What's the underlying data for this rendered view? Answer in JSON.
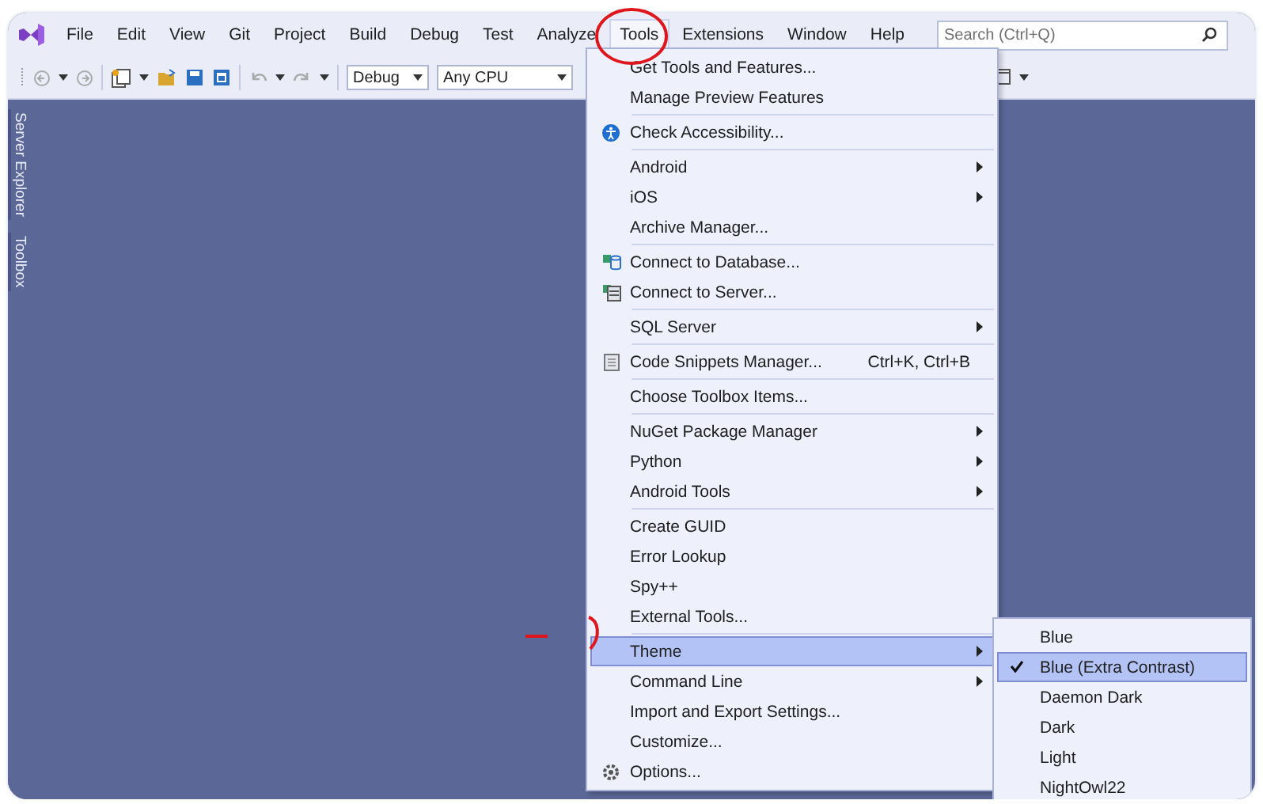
{
  "menu_bar": [
    {
      "label": "File",
      "selected": false
    },
    {
      "label": "Edit",
      "selected": false
    },
    {
      "label": "View",
      "selected": false
    },
    {
      "label": "Git",
      "selected": false
    },
    {
      "label": "Project",
      "selected": false
    },
    {
      "label": "Build",
      "selected": false
    },
    {
      "label": "Debug",
      "selected": false
    },
    {
      "label": "Test",
      "selected": false
    },
    {
      "label": "Analyze",
      "selected": false
    },
    {
      "label": "Tools",
      "selected": true
    },
    {
      "label": "Extensions",
      "selected": false
    },
    {
      "label": "Window",
      "selected": false
    },
    {
      "label": "Help",
      "selected": false
    }
  ],
  "search": {
    "placeholder": "Search (Ctrl+Q)"
  },
  "toolbar": {
    "configuration": "Debug",
    "platform": "Any CPU"
  },
  "side_tabs": [
    "Server Explorer",
    "Toolbox"
  ],
  "tools_menu": [
    [
      {
        "label": "Get Tools and Features...",
        "submenu": false,
        "highlighted": false
      },
      {
        "label": "Manage Preview Features",
        "submenu": false,
        "highlighted": false
      }
    ],
    [
      {
        "label": "Check Accessibility...",
        "kind": "accessibility",
        "submenu": false,
        "highlighted": false
      }
    ],
    [
      {
        "label": "Android",
        "submenu": true,
        "highlighted": false
      },
      {
        "label": "iOS",
        "submenu": true,
        "highlighted": false
      },
      {
        "label": "Archive Manager...",
        "submenu": false,
        "highlighted": false
      }
    ],
    [
      {
        "label": "Connect to Database...",
        "kind": "database",
        "submenu": false,
        "highlighted": false
      },
      {
        "label": "Connect to Server...",
        "kind": "server",
        "submenu": false,
        "highlighted": false
      }
    ],
    [
      {
        "label": "SQL Server",
        "submenu": true,
        "highlighted": false
      }
    ],
    [
      {
        "label": "Code Snippets Manager...",
        "kind": "snippet",
        "shortcut": "Ctrl+K, Ctrl+B",
        "submenu": false,
        "highlighted": false
      }
    ],
    [
      {
        "label": "Choose Toolbox Items...",
        "submenu": false,
        "highlighted": false
      }
    ],
    [
      {
        "label": "NuGet Package Manager",
        "submenu": true,
        "highlighted": false
      },
      {
        "label": "Python",
        "submenu": true,
        "highlighted": false
      },
      {
        "label": "Android Tools",
        "submenu": true,
        "highlighted": false
      }
    ],
    [
      {
        "label": "Create GUID",
        "submenu": false,
        "highlighted": false
      },
      {
        "label": "Error Lookup",
        "submenu": false,
        "highlighted": false
      },
      {
        "label": "Spy++",
        "submenu": false,
        "highlighted": false
      },
      {
        "label": "External Tools...",
        "submenu": false,
        "highlighted": false
      }
    ],
    [
      {
        "label": "Theme",
        "submenu": true,
        "highlighted": true
      },
      {
        "label": "Command Line",
        "submenu": true,
        "highlighted": false
      },
      {
        "label": "Import and Export Settings...",
        "submenu": false,
        "highlighted": false
      },
      {
        "label": "Customize...",
        "submenu": false,
        "highlighted": false
      },
      {
        "label": "Options...",
        "kind": "gear",
        "submenu": false,
        "highlighted": false
      }
    ]
  ],
  "theme_submenu": [
    {
      "label": "Blue",
      "checked": false,
      "selected": false
    },
    {
      "label": "Blue (Extra Contrast)",
      "checked": true,
      "selected": true
    },
    {
      "label": "Daemon Dark",
      "checked": false,
      "selected": false
    },
    {
      "label": "Dark",
      "checked": false,
      "selected": false
    },
    {
      "label": "Light",
      "checked": false,
      "selected": false
    },
    {
      "label": "NightOwl22",
      "checked": false,
      "selected": false
    }
  ]
}
